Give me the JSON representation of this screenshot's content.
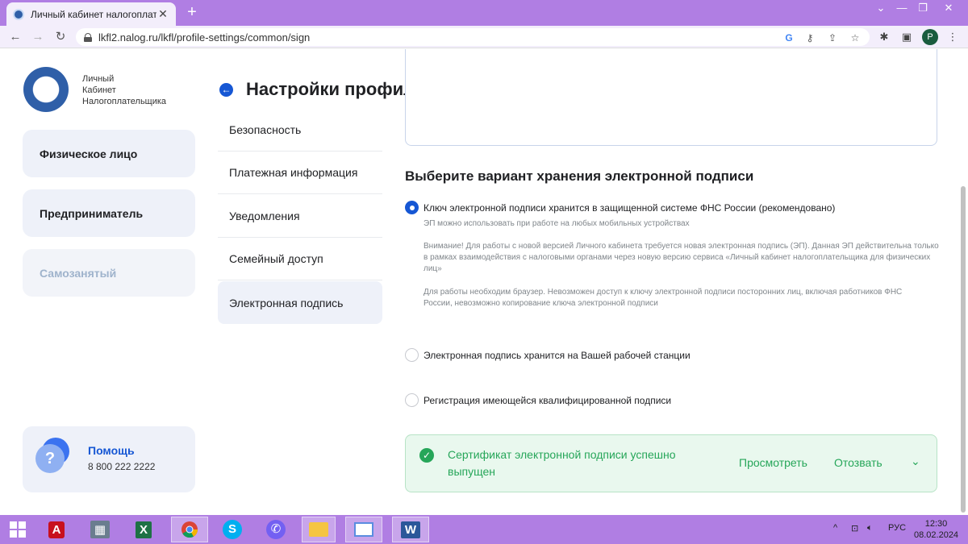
{
  "browser": {
    "tab_title": "Личный кабинет налогоплател",
    "tab_close": "✕",
    "new_tab": "+",
    "url": "lkfl2.nalog.ru/lkfl/profile-settings/common/sign",
    "profile_initial": "P"
  },
  "header": {
    "logo_text": [
      "Личный",
      "Кабинет",
      "Налогоплательщика"
    ],
    "page_title": "Настройки профиля",
    "icons": [
      "search-icon",
      "mail-icon",
      "eye-off-icon",
      "lightbulb-icon",
      "user-icon"
    ]
  },
  "sidebar": {
    "items": [
      {
        "label": "Физическое лицо",
        "enabled": true
      },
      {
        "label": "Предприниматель",
        "enabled": true
      },
      {
        "label": "Самозанятый",
        "enabled": false
      }
    ],
    "help": {
      "title": "Помощь",
      "phone": "8 800 222 2222"
    }
  },
  "settings_menu": {
    "items": [
      "Безопасность",
      "Платежная информация",
      "Уведомления",
      "Семейный доступ",
      "Электронная подпись"
    ],
    "active_index": 4
  },
  "signature": {
    "section_title": "Выберите вариант хранения электронной подписи",
    "options": [
      {
        "label": "Ключ электронной подписи хранится в защищенной системе ФНС России (рекомендовано)",
        "checked": true,
        "note_1": "ЭП можно использовать при работе на любых мобильных устройствах",
        "note_2": "Внимание! Для работы с новой версией Личного кабинета требуется новая электронная подпись (ЭП). Данная ЭП действительна только в рамках взаимодействия с налоговыми органами через новую версию сервиса «Личный кабинет налогоплательщика для физических лиц»",
        "note_3": "Для работы необходим браузер. Невозможен доступ к ключу электронной подписи посторонних лиц, включая работников ФНС России, невозможно копирование ключа электронной подписи"
      },
      {
        "label": "Электронная подпись хранится на Вашей рабочей станции",
        "checked": false
      },
      {
        "label": "Регистрация имеющейся квалифицированной подписи",
        "checked": false
      }
    ],
    "success": {
      "message": "Сертификат электронной подписи успешно выпущен",
      "view": "Просмотреть",
      "revoke": "Отозвать"
    }
  },
  "taskbar": {
    "apps": [
      "start",
      "acrobat",
      "calculator",
      "excel",
      "chrome",
      "skype",
      "viber",
      "file-explorer",
      "screenshot-tool",
      "word"
    ],
    "active_app": "chrome",
    "language": "РУС",
    "time": "12:30",
    "date": "08.02.2024"
  },
  "colors": {
    "accent": "#1657d4",
    "success": "#26a659",
    "taskbar": "#b07ee3"
  }
}
